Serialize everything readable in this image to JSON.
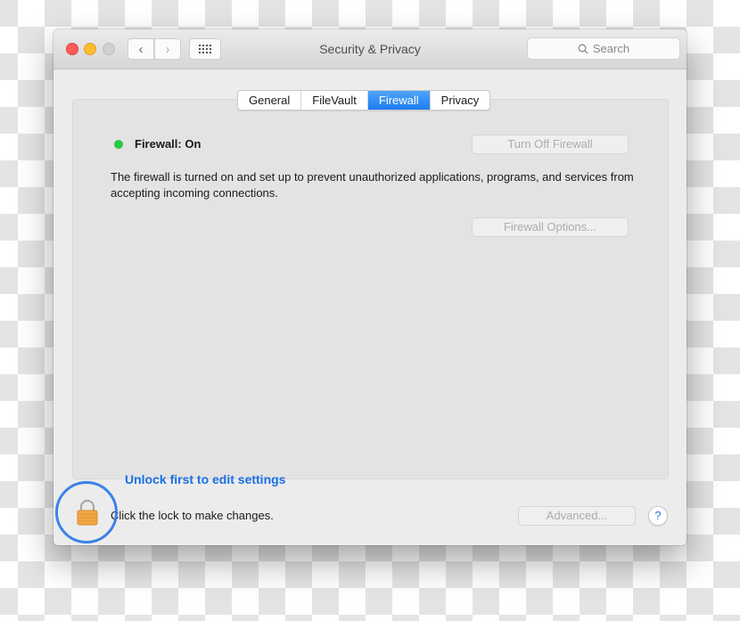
{
  "window": {
    "title": "Security & Privacy",
    "search_placeholder": "Search",
    "nav": {
      "back_icon": "chevron-left-icon",
      "forward_icon": "chevron-right-icon",
      "grid_icon": "show-all-grid-icon"
    }
  },
  "tabs": [
    {
      "label": "General",
      "active": false
    },
    {
      "label": "FileVault",
      "active": false
    },
    {
      "label": "Firewall",
      "active": true
    },
    {
      "label": "Privacy",
      "active": false
    }
  ],
  "firewall": {
    "status_label": "Firewall: On",
    "status_color": "#28c840",
    "description": "The firewall is turned on and set up to prevent unauthorized applications, programs, and services from accepting incoming connections.",
    "turn_off_label": "Turn Off Firewall",
    "options_label": "Firewall Options..."
  },
  "footer": {
    "annotation": "Unlock first to edit settings",
    "lock_hint": "Click the lock to make changes.",
    "advanced_label": "Advanced...",
    "help_label": "?"
  },
  "colors": {
    "accent": "#1d7cf2",
    "annotation": "#1a6fe6",
    "lock": "#f0a440"
  }
}
